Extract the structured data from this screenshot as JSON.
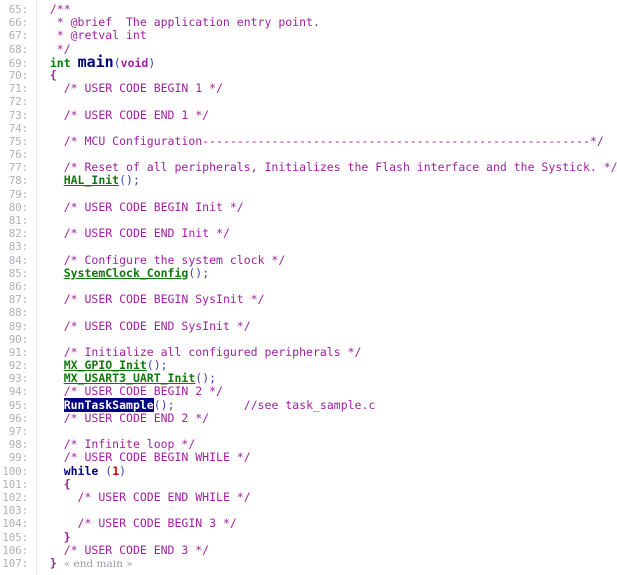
{
  "editor": {
    "language": "c",
    "file_reference": "task_sample.c",
    "selection_text": "RunTaskSample",
    "colors": {
      "background": "#ffffff",
      "gutter_text": "#b0b0b8",
      "comment": "#a020a0",
      "keyword": "#000080",
      "type": "#008000",
      "function_call": "#117711",
      "number": "#cc0000",
      "punctuation": "#4040b0",
      "selection_background": "#000080",
      "selection_text": "#ffffff",
      "indent_guide": "#e8e8ec"
    },
    "first_line": 65,
    "last_line": 107,
    "lines": [
      {
        "n": "65:",
        "tokens": [
          {
            "t": "  ",
            "c": "t-plain"
          },
          {
            "t": "/**",
            "c": "t-comment"
          }
        ]
      },
      {
        "n": "66:",
        "tokens": [
          {
            "t": "   * @brief  The application entry point.",
            "c": "t-comment"
          }
        ]
      },
      {
        "n": "67:",
        "tokens": [
          {
            "t": "   * @retval int",
            "c": "t-comment"
          }
        ]
      },
      {
        "n": "68:",
        "tokens": [
          {
            "t": "   */",
            "c": "t-comment"
          }
        ]
      },
      {
        "n": "69:",
        "tokens": [
          {
            "t": "  ",
            "c": "t-plain"
          },
          {
            "t": "int",
            "c": "t-type"
          },
          {
            "t": " ",
            "c": "t-plain"
          },
          {
            "t": "main",
            "c": "t-fnname"
          },
          {
            "t": "(",
            "c": "t-punct"
          },
          {
            "t": "void",
            "c": "t-vkw"
          },
          {
            "t": ")",
            "c": "t-punct"
          }
        ]
      },
      {
        "n": "70:",
        "tokens": [
          {
            "t": "  ",
            "c": "t-plain"
          },
          {
            "t": "{",
            "c": "t-brace"
          }
        ]
      },
      {
        "n": "71:",
        "tokens": [
          {
            "t": "    ",
            "c": "t-plain"
          },
          {
            "t": "/* USER CODE BEGIN 1 */",
            "c": "t-comment"
          }
        ]
      },
      {
        "n": "72:",
        "tokens": []
      },
      {
        "n": "73:",
        "tokens": [
          {
            "t": "    ",
            "c": "t-plain"
          },
          {
            "t": "/* USER CODE END 1 */",
            "c": "t-comment"
          }
        ]
      },
      {
        "n": "74:",
        "tokens": []
      },
      {
        "n": "75:",
        "tokens": [
          {
            "t": "    ",
            "c": "t-plain"
          },
          {
            "t": "/* MCU Configuration--------------------------------------------------------*/",
            "c": "t-comment"
          }
        ]
      },
      {
        "n": "76:",
        "tokens": []
      },
      {
        "n": "77:",
        "tokens": [
          {
            "t": "    ",
            "c": "t-plain"
          },
          {
            "t": "/* Reset of all peripherals, Initializes the Flash interface and the Systick. */",
            "c": "t-comment"
          }
        ]
      },
      {
        "n": "78:",
        "tokens": [
          {
            "t": "    ",
            "c": "t-plain"
          },
          {
            "t": "HAL_Init",
            "c": "t-call"
          },
          {
            "t": "()",
            "c": "t-punct"
          },
          {
            "t": ";",
            "c": "t-punct"
          }
        ]
      },
      {
        "n": "79:",
        "tokens": []
      },
      {
        "n": "80:",
        "tokens": [
          {
            "t": "    ",
            "c": "t-plain"
          },
          {
            "t": "/* USER CODE BEGIN Init */",
            "c": "t-comment"
          }
        ]
      },
      {
        "n": "81:",
        "tokens": []
      },
      {
        "n": "82:",
        "tokens": [
          {
            "t": "    ",
            "c": "t-plain"
          },
          {
            "t": "/* USER CODE END Init */",
            "c": "t-comment"
          }
        ]
      },
      {
        "n": "83:",
        "tokens": []
      },
      {
        "n": "84:",
        "tokens": [
          {
            "t": "    ",
            "c": "t-plain"
          },
          {
            "t": "/* Configure the system clock */",
            "c": "t-comment"
          }
        ]
      },
      {
        "n": "85:",
        "tokens": [
          {
            "t": "    ",
            "c": "t-plain"
          },
          {
            "t": "SystemClock_Config",
            "c": "t-call"
          },
          {
            "t": "()",
            "c": "t-punct"
          },
          {
            "t": ";",
            "c": "t-punct"
          }
        ]
      },
      {
        "n": "86:",
        "tokens": []
      },
      {
        "n": "87:",
        "tokens": [
          {
            "t": "    ",
            "c": "t-plain"
          },
          {
            "t": "/* USER CODE BEGIN SysInit */",
            "c": "t-comment"
          }
        ]
      },
      {
        "n": "88:",
        "tokens": []
      },
      {
        "n": "89:",
        "tokens": [
          {
            "t": "    ",
            "c": "t-plain"
          },
          {
            "t": "/* USER CODE END SysInit */",
            "c": "t-comment"
          }
        ]
      },
      {
        "n": "90:",
        "tokens": []
      },
      {
        "n": "91:",
        "tokens": [
          {
            "t": "    ",
            "c": "t-plain"
          },
          {
            "t": "/* Initialize all configured peripherals */",
            "c": "t-comment"
          }
        ]
      },
      {
        "n": "92:",
        "tokens": [
          {
            "t": "    ",
            "c": "t-plain"
          },
          {
            "t": "MX_GPIO_Init",
            "c": "t-call"
          },
          {
            "t": "()",
            "c": "t-punct"
          },
          {
            "t": ";",
            "c": "t-punct"
          }
        ]
      },
      {
        "n": "93:",
        "tokens": [
          {
            "t": "    ",
            "c": "t-plain"
          },
          {
            "t": "MX_USART3_UART_Init",
            "c": "t-call"
          },
          {
            "t": "()",
            "c": "t-punct"
          },
          {
            "t": ";",
            "c": "t-punct"
          }
        ]
      },
      {
        "n": "94:",
        "tokens": [
          {
            "t": "    ",
            "c": "t-plain"
          },
          {
            "t": "/* USER CODE BEGIN 2 */",
            "c": "t-comment"
          }
        ]
      },
      {
        "n": "95:",
        "tokens": [
          {
            "t": "    ",
            "c": "t-plain"
          },
          {
            "t": "RunTaskSample",
            "c": "t-sel"
          },
          {
            "t": "()",
            "c": "t-punct"
          },
          {
            "t": ";",
            "c": "t-punct"
          },
          {
            "t": "          ",
            "c": "t-plain"
          },
          {
            "t": "//see task_sample.c",
            "c": "t-comment"
          }
        ]
      },
      {
        "n": "96:",
        "tokens": [
          {
            "t": "    ",
            "c": "t-plain"
          },
          {
            "t": "/* USER CODE END 2 */",
            "c": "t-comment"
          }
        ]
      },
      {
        "n": "97:",
        "tokens": []
      },
      {
        "n": "98:",
        "tokens": [
          {
            "t": "    ",
            "c": "t-plain"
          },
          {
            "t": "/* Infinite loop */",
            "c": "t-comment"
          }
        ]
      },
      {
        "n": "99:",
        "tokens": [
          {
            "t": "    ",
            "c": "t-plain"
          },
          {
            "t": "/* USER CODE BEGIN WHILE */",
            "c": "t-comment"
          }
        ]
      },
      {
        "n": "100:",
        "tokens": [
          {
            "t": "    ",
            "c": "t-plain"
          },
          {
            "t": "while",
            "c": "t-kw"
          },
          {
            "t": " ",
            "c": "t-plain"
          },
          {
            "t": "(",
            "c": "t-punct"
          },
          {
            "t": "1",
            "c": "t-num"
          },
          {
            "t": ")",
            "c": "t-punct"
          }
        ]
      },
      {
        "n": "101:",
        "tokens": [
          {
            "t": "    ",
            "c": "t-plain"
          },
          {
            "t": "{",
            "c": "t-brace"
          }
        ]
      },
      {
        "n": "102:",
        "tokens": [
          {
            "t": "      ",
            "c": "t-plain"
          },
          {
            "t": "/* USER CODE END WHILE */",
            "c": "t-comment"
          }
        ]
      },
      {
        "n": "103:",
        "tokens": []
      },
      {
        "n": "104:",
        "tokens": [
          {
            "t": "      ",
            "c": "t-plain"
          },
          {
            "t": "/* USER CODE BEGIN 3 */",
            "c": "t-comment"
          }
        ]
      },
      {
        "n": "105:",
        "tokens": [
          {
            "t": "    ",
            "c": "t-plain"
          },
          {
            "t": "}",
            "c": "t-brace"
          }
        ]
      },
      {
        "n": "106:",
        "tokens": [
          {
            "t": "    ",
            "c": "t-plain"
          },
          {
            "t": "/* USER CODE END 3 */",
            "c": "t-comment"
          }
        ]
      },
      {
        "n": "107:",
        "tokens": [
          {
            "t": "  ",
            "c": "t-plain"
          },
          {
            "t": "}",
            "c": "t-brace"
          },
          {
            "t": " ",
            "c": "t-plain"
          },
          {
            "t": "« end main »",
            "c": "t-fold"
          }
        ]
      }
    ]
  }
}
